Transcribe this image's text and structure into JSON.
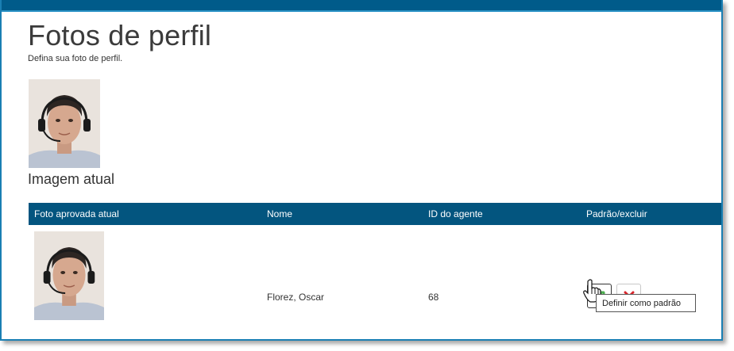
{
  "page": {
    "title": "Fotos de perfil",
    "subtitle": "Defina sua foto de perfil.",
    "current_image_label": "Imagem atual"
  },
  "table": {
    "columns": [
      "Foto aprovada atual",
      "Nome",
      "ID do agente",
      "Padrão/excluir"
    ],
    "rows": [
      {
        "name": "Florez, Oscar",
        "agent_id": "68"
      }
    ]
  },
  "tooltip": {
    "text": "Definir como padrão"
  },
  "icons": {
    "set_default": "check-square-icon",
    "delete": "x-icon",
    "cursor": "hand-pointer-icon"
  },
  "colors": {
    "header_bar": "#005b8a",
    "table_header": "#03557f",
    "check_green": "#4caf50",
    "delete_red": "#d9262c"
  }
}
